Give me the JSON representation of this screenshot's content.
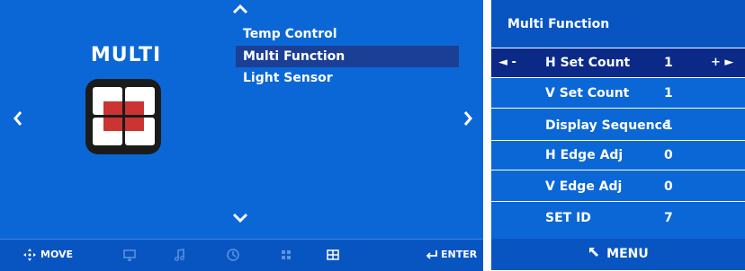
{
  "left_panel": {
    "title": "MULTI",
    "menu_items": [
      "Temp Control",
      "Multi Function",
      "Light Sensor"
    ],
    "selected_menu_index": 1,
    "bottom_bar": {
      "move_label": "MOVE",
      "enter_label": "ENTER",
      "icons": [
        "monitor-icon",
        "music-icon",
        "clock-icon",
        "grid-icon",
        "multi-screen-icon"
      ]
    }
  },
  "right_panel": {
    "title": "Multi Function",
    "rows": [
      {
        "label": "H Set Count",
        "value": "1"
      },
      {
        "label": "V Set Count",
        "value": "1"
      },
      {
        "label": "Display Sequence",
        "value": "1"
      },
      {
        "label": "H Edge Adj",
        "value": "0"
      },
      {
        "label": "V Edge Adj",
        "value": "0"
      },
      {
        "label": "SET ID",
        "value": "7"
      }
    ],
    "selected_row_index": 0,
    "decrement_label": "◄ -",
    "increment_label": "+ ►",
    "footer_label": "MENU"
  },
  "colors": {
    "panel_bg": "#0b67d6",
    "bar_bg": "#0855c2",
    "selection_bg": "#1c3f96",
    "icon_red": "#cc3333"
  }
}
